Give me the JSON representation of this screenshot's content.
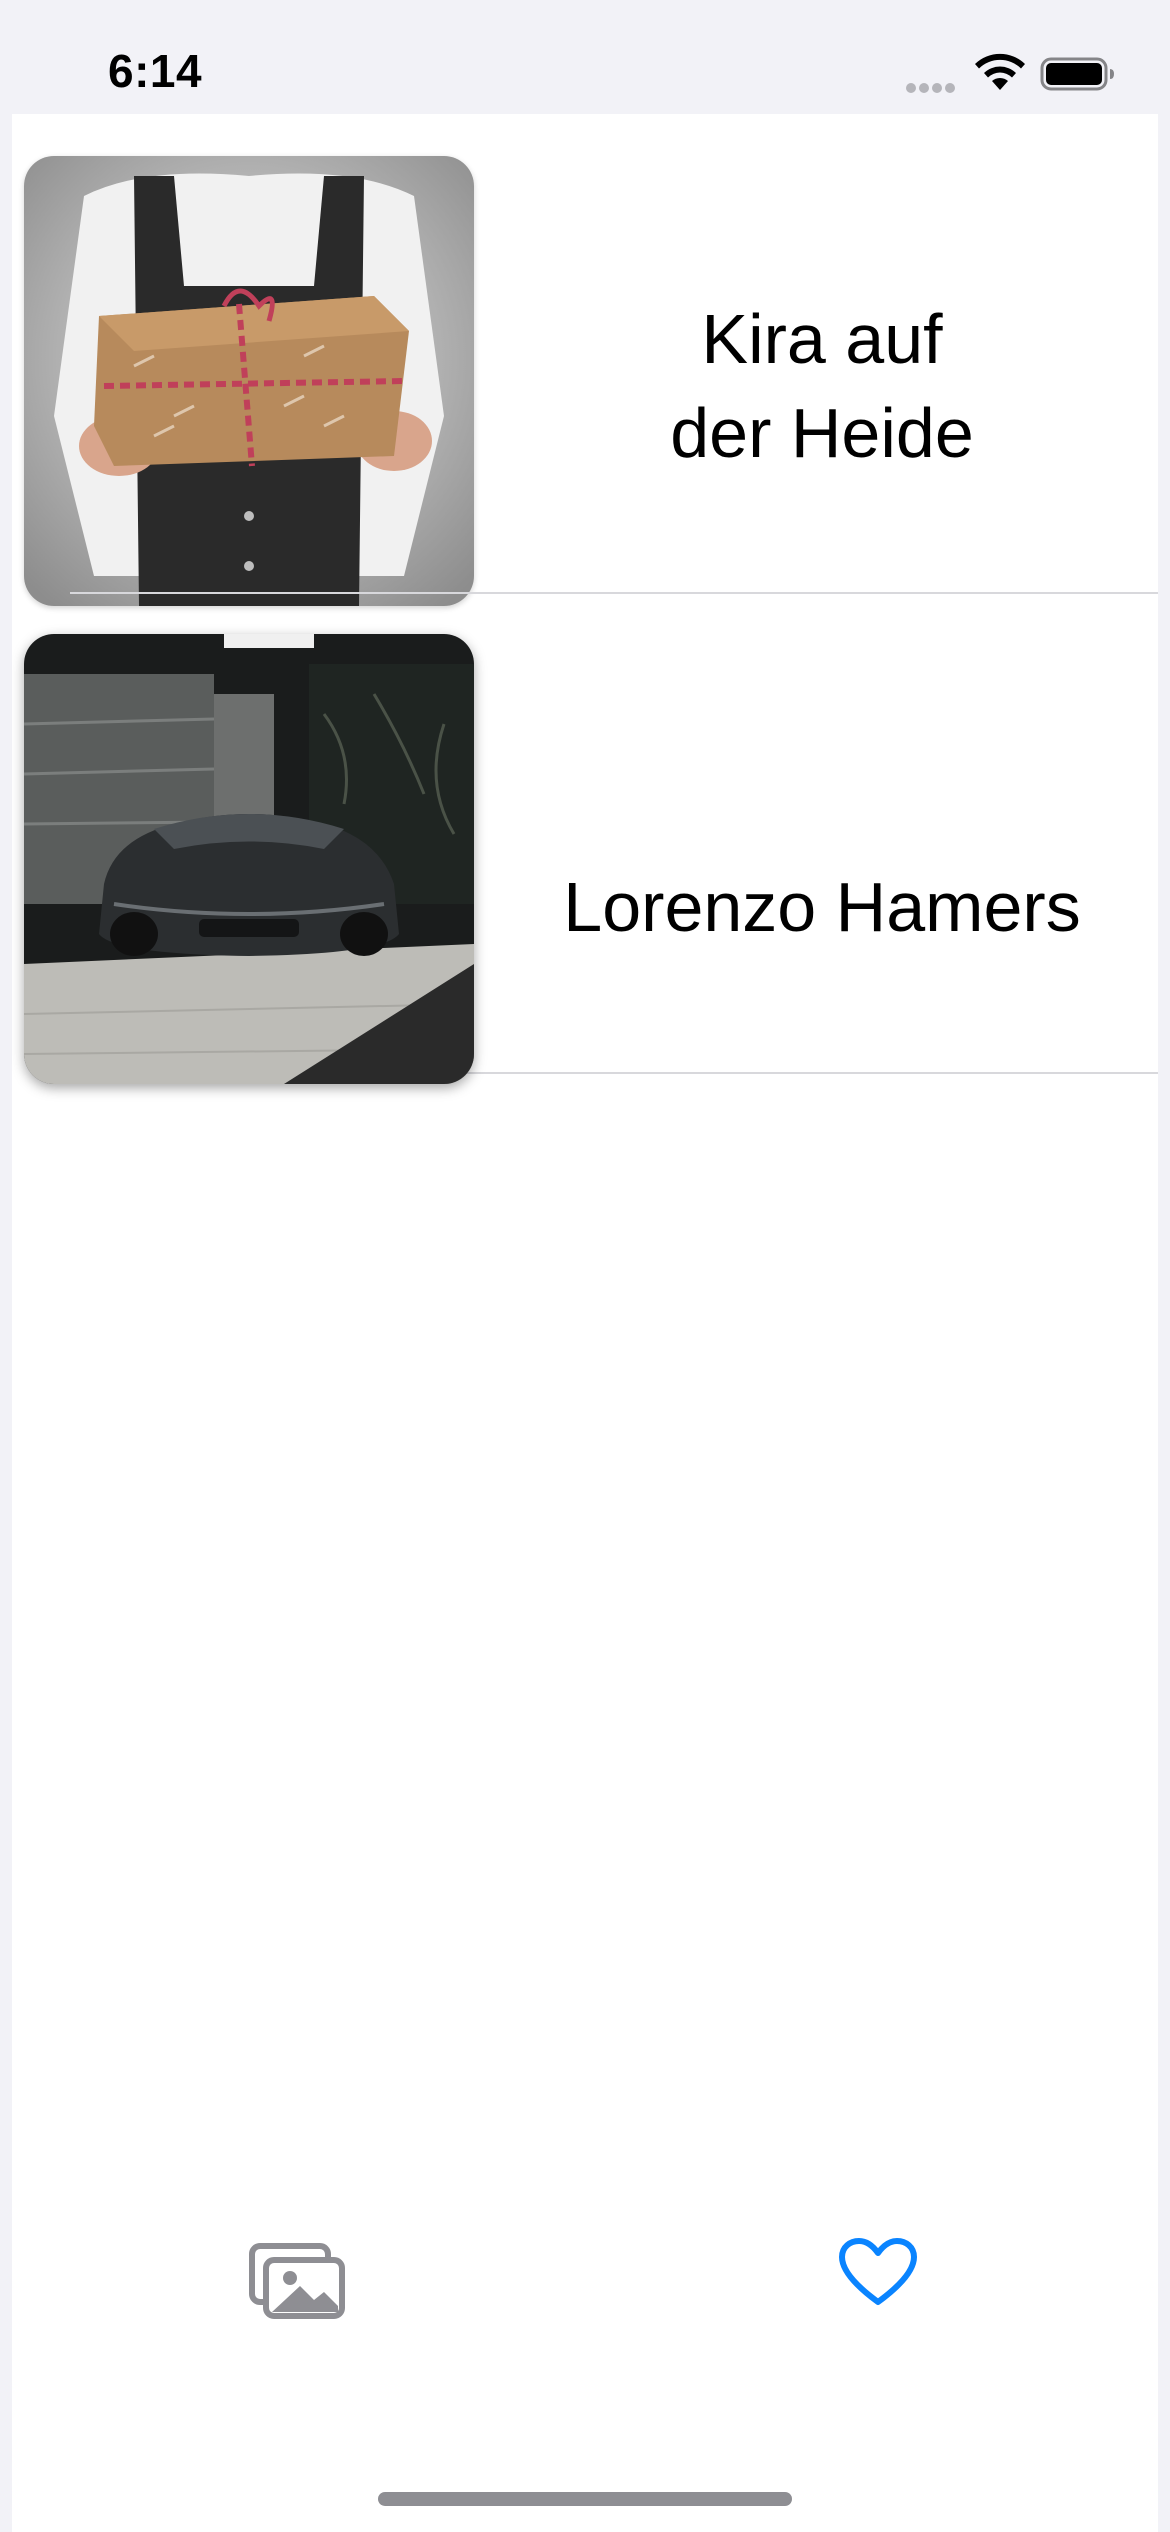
{
  "status_bar": {
    "time": "6:14",
    "signal_icon": "signal-dots-icon",
    "wifi_icon": "wifi-icon",
    "battery_icon": "battery-icon"
  },
  "list": {
    "items": [
      {
        "title_line1": "Kira auf",
        "title_line2": "der Heide",
        "image": "gift-box-photo"
      },
      {
        "title": "Lorenzo Hamers",
        "image": "sports-car-garage-photo"
      }
    ]
  },
  "tab_bar": {
    "tabs": [
      {
        "icon": "photos-icon",
        "selected": false,
        "color": "#8e8e93"
      },
      {
        "icon": "heart-icon",
        "selected": true,
        "color": "#0a84ff"
      }
    ]
  },
  "colors": {
    "background": "#f2f2f7",
    "content": "#ffffff",
    "accent": "#0a84ff",
    "separator": "#d8d8dc"
  }
}
